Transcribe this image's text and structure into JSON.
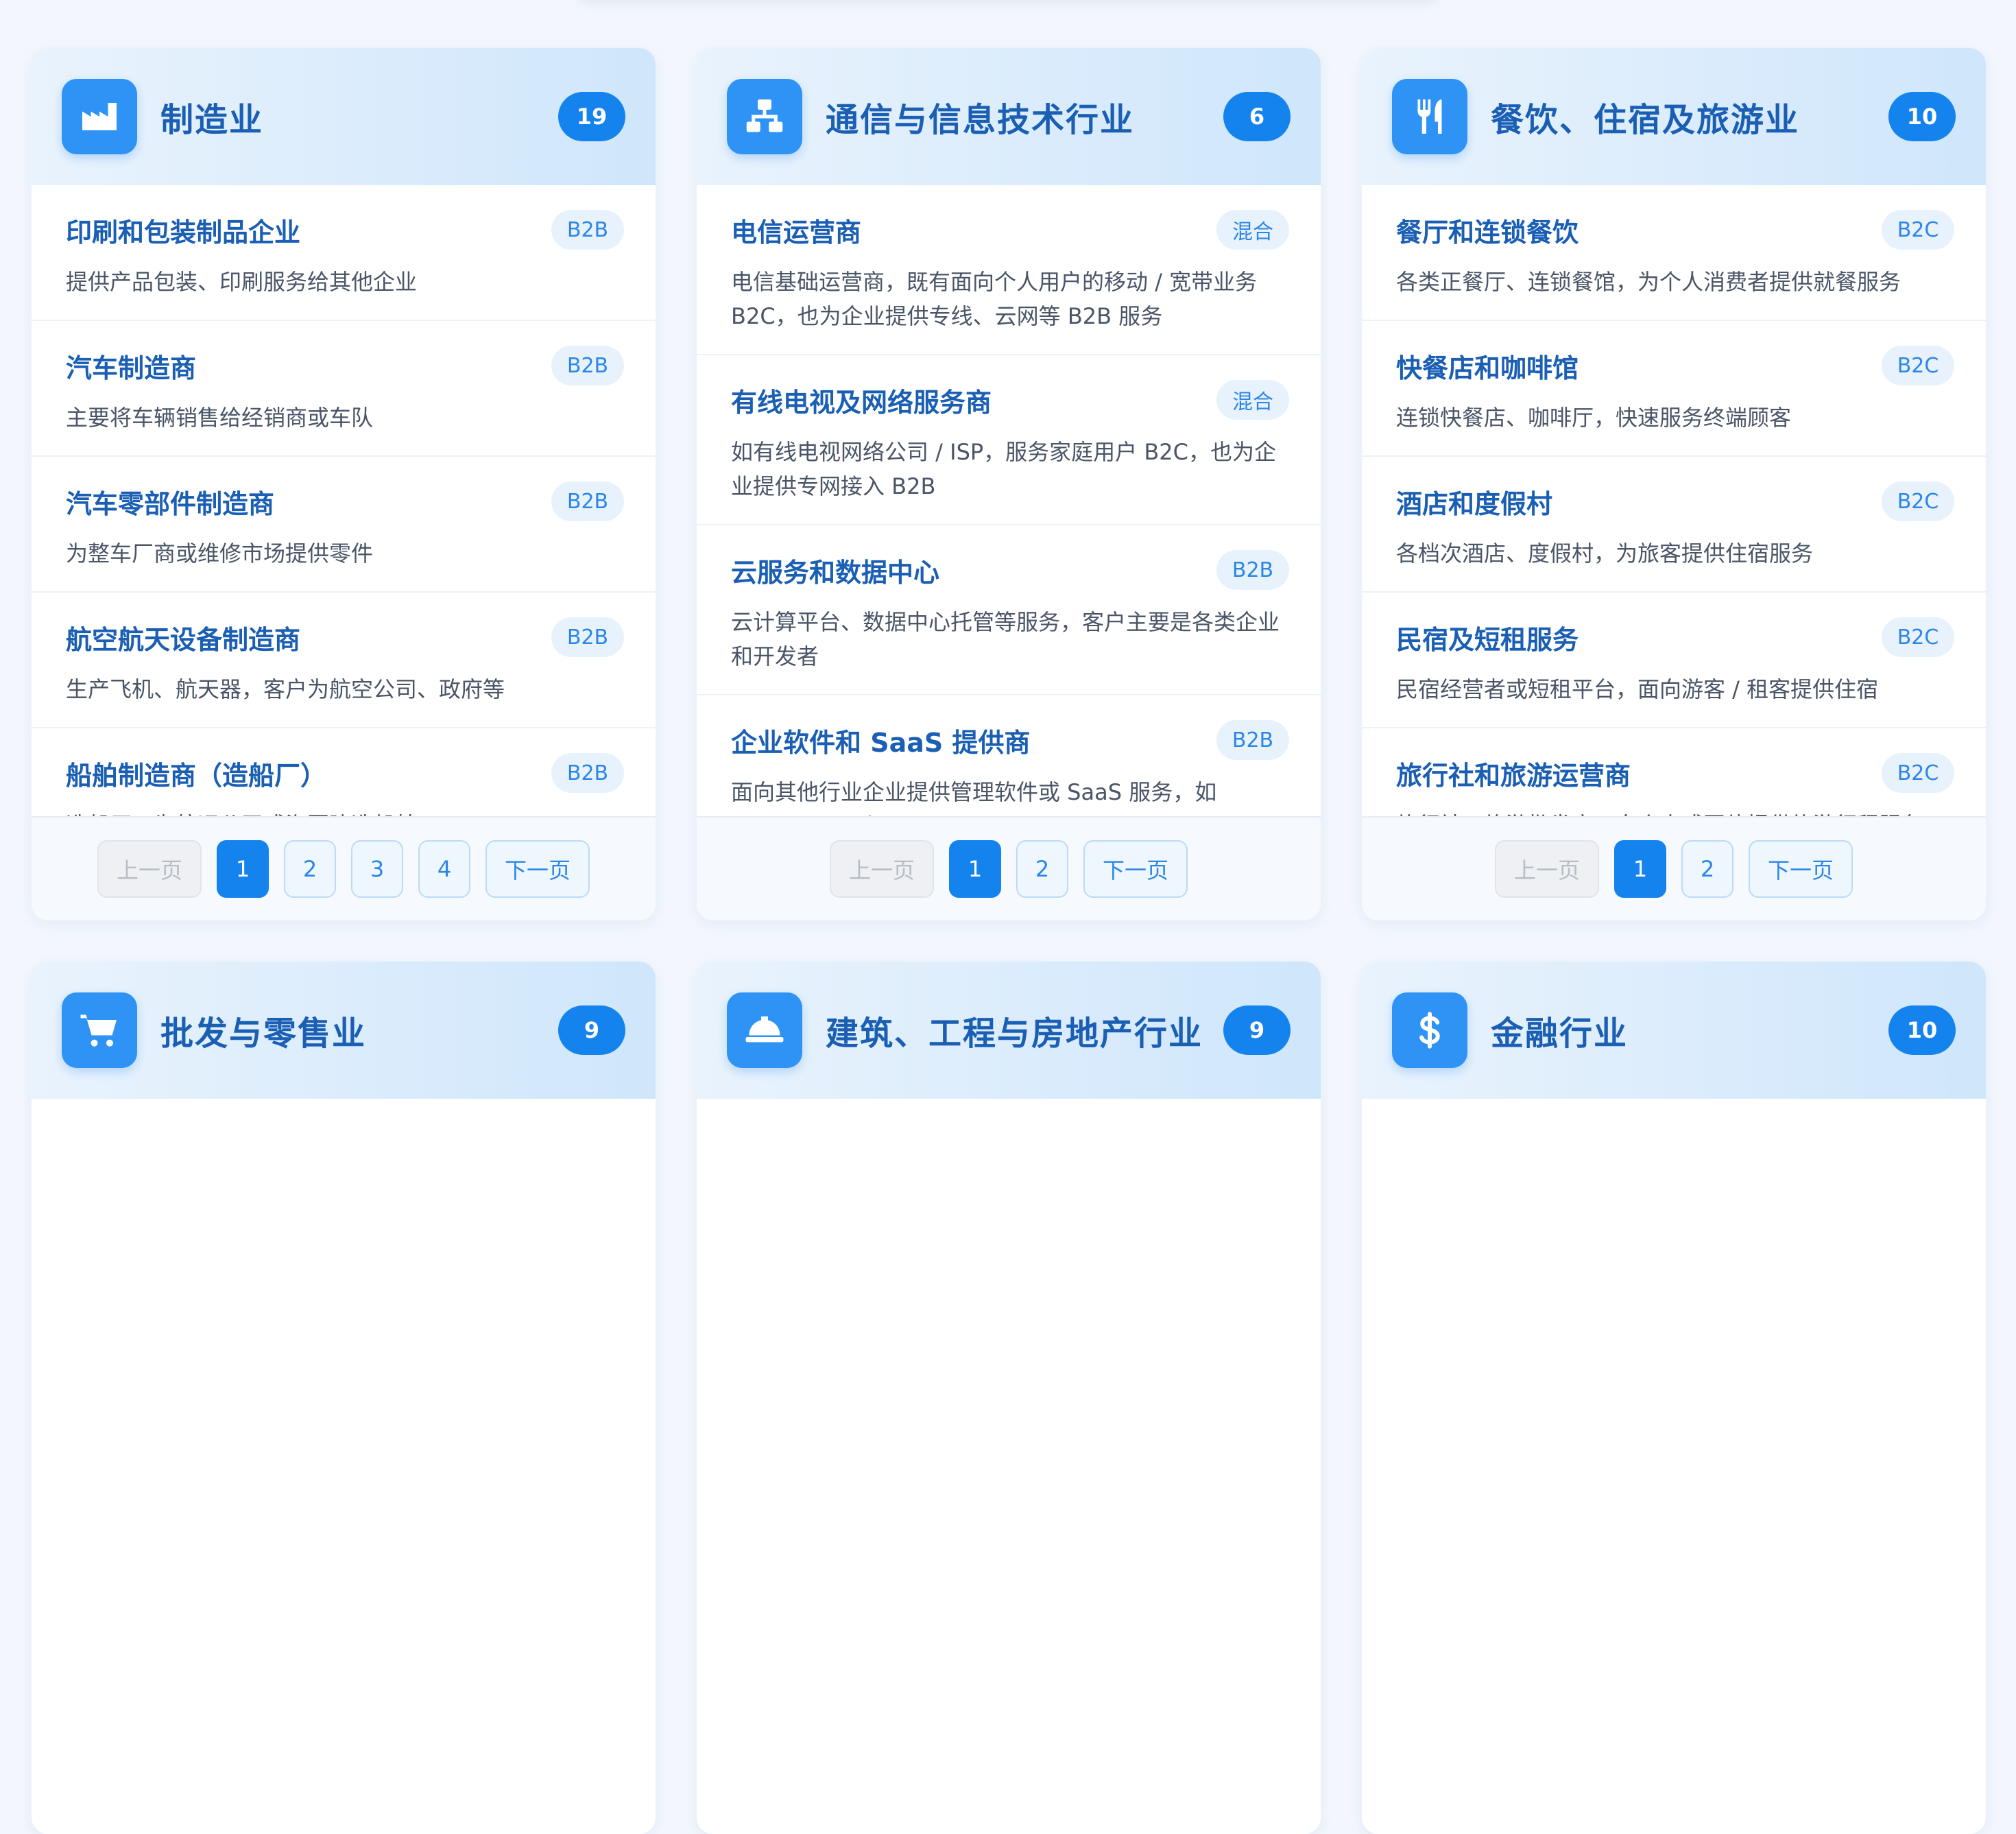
{
  "categories": [
    {
      "title": "制造业",
      "count": "19",
      "icon": "factory-icon",
      "items": [
        {
          "name": "印刷和包装制品企业",
          "tag": "B2B",
          "desc": "提供产品包装、印刷服务给其他企业"
        },
        {
          "name": "汽车制造商",
          "tag": "B2B",
          "desc": "主要将车辆销售给经销商或车队"
        },
        {
          "name": "汽车零部件制造商",
          "tag": "B2B",
          "desc": "为整车厂商或维修市场提供零件"
        },
        {
          "name": "航空航天设备制造商",
          "tag": "B2B",
          "desc": "生产飞机、航天器，客户为航空公司、政府等"
        },
        {
          "name": "船舶制造商（造船厂）",
          "tag": "B2B",
          "desc": "造船厂，为航运公司或海军建造船舶"
        }
      ],
      "pager": {
        "prev": "上一页",
        "next": "下一页",
        "pages": [
          "1",
          "2",
          "3",
          "4"
        ]
      }
    },
    {
      "title": "通信与信息技术行业",
      "count": "6",
      "icon": "network-icon",
      "items": [
        {
          "name": "电信运营商",
          "tag": "混合",
          "desc": "电信基础运营商，既有面向个人用户的移动 / 宽带业务 B2C，也为企业提供专线、云网等 B2B 服务"
        },
        {
          "name": "有线电视及网络服务商",
          "tag": "混合",
          "desc": "如有线电视网络公司 / ISP，服务家庭用户 B2C，也为企业提供专网接入 B2B"
        },
        {
          "name": "云服务和数据中心",
          "tag": "B2B",
          "desc": "云计算平台、数据中心托管等服务，客户主要是各类企业和开发者"
        },
        {
          "name": "企业软件和 SaaS 提供商",
          "tag": "B2B",
          "desc": "面向其他行业企业提供管理软件或 SaaS 服务，如 ERP/CRM 厂商"
        }
      ],
      "pager": {
        "prev": "上一页",
        "next": "下一页",
        "pages": [
          "1",
          "2"
        ]
      }
    },
    {
      "title": "餐饮、住宿及旅游业",
      "count": "10",
      "icon": "fork-knife-icon",
      "items": [
        {
          "name": "餐厅和连锁餐饮",
          "tag": "B2C",
          "desc": "各类正餐厅、连锁餐馆，为个人消费者提供就餐服务"
        },
        {
          "name": "快餐店和咖啡馆",
          "tag": "B2C",
          "desc": "连锁快餐店、咖啡厅，快速服务终端顾客"
        },
        {
          "name": "酒店和度假村",
          "tag": "B2C",
          "desc": "各档次酒店、度假村，为旅客提供住宿服务"
        },
        {
          "name": "民宿及短租服务",
          "tag": "B2C",
          "desc": "民宿经营者或短租平台，面向游客 / 租客提供住宿"
        },
        {
          "name": "旅行社和旅游运营商",
          "tag": "B2C",
          "desc": "旅行社、旅游批发商，向个人或团体提供旅游行程服务"
        }
      ],
      "pager": {
        "prev": "上一页",
        "next": "下一页",
        "pages": [
          "1",
          "2"
        ]
      }
    },
    {
      "title": "批发与零售业",
      "count": "9",
      "icon": "shopping-cart-icon"
    },
    {
      "title": "建筑、工程与房地产行业",
      "count": "9",
      "icon": "hard-hat-icon"
    },
    {
      "title": "金融行业",
      "count": "10",
      "icon": "dollar-icon"
    }
  ],
  "colors": {
    "accent": "#1583ee",
    "title": "#1a5fb4",
    "tag_bg": "#e8f2fd"
  }
}
